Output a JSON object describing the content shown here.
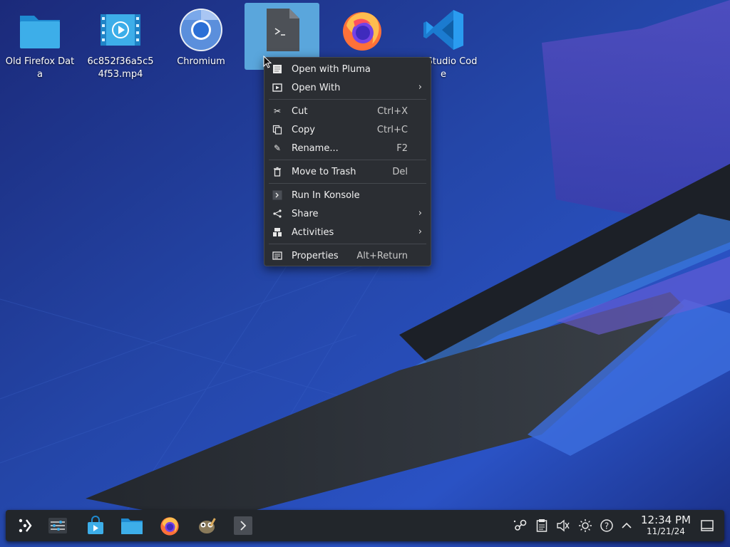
{
  "desktop": {
    "icons": [
      {
        "label": "Old Firefox Data",
        "icon": "folder-icon"
      },
      {
        "label": "6c852f36a5c54f53.mp4",
        "icon": "video-file-icon"
      },
      {
        "label": "Chromium",
        "icon": "chromium-icon"
      },
      {
        "label": "",
        "icon": "script-file-icon",
        "selected": true
      },
      {
        "label": "",
        "icon": "firefox-icon"
      },
      {
        "label": "Visual Studio Code",
        "icon": "vscode-icon",
        "visible_text": "ual Studio Code"
      }
    ]
  },
  "context_menu": {
    "items": {
      "open_with_pluma": {
        "label": "Open with Pluma",
        "icon": "pluma-icon"
      },
      "open_with": {
        "label": "Open With",
        "icon": "open-with-icon",
        "submenu": true
      },
      "cut": {
        "label": "Cut",
        "shortcut": "Ctrl+X",
        "icon": "scissors-icon"
      },
      "copy": {
        "label": "Copy",
        "shortcut": "Ctrl+C",
        "icon": "copy-icon"
      },
      "rename": {
        "label": "Rename...",
        "shortcut": "F2",
        "icon": "pencil-icon"
      },
      "trash": {
        "label": "Move to Trash",
        "shortcut": "Del",
        "icon": "trash-icon"
      },
      "run_konsole": {
        "label": "Run In Konsole",
        "icon": "terminal-icon"
      },
      "share": {
        "label": "Share",
        "icon": "share-icon",
        "submenu": true
      },
      "activities": {
        "label": "Activities",
        "icon": "activities-icon",
        "submenu": true
      },
      "properties": {
        "label": "Properties",
        "shortcut": "Alt+Return",
        "icon": "properties-icon"
      }
    }
  },
  "taskbar": {
    "launchers": [
      "application-launcher-icon",
      "system-settings-icon",
      "discover-store-icon",
      "file-manager-icon",
      "firefox-icon",
      "gimp-icon",
      "konsole-icon"
    ],
    "tray": [
      "steam-icon",
      "clipboard-icon",
      "volume-muted-icon",
      "brightness-icon",
      "help-icon",
      "tray-expand-icon"
    ],
    "clock": {
      "time": "12:34 PM",
      "date": "11/21/24"
    },
    "show_desktop": "show-desktop-icon"
  },
  "colors": {
    "selection": "#5aa6dc",
    "menu_bg": "#2b2e33",
    "taskbar_bg": "#22262b"
  }
}
